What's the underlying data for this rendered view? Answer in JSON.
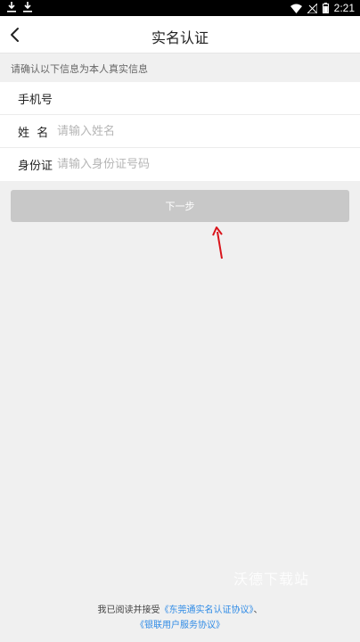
{
  "statusbar": {
    "time": "2:21",
    "icons": [
      "download-icon",
      "download-icon",
      "wifi-icon",
      "signal-off-icon",
      "battery-icon"
    ]
  },
  "nav": {
    "title": "实名认证",
    "back_icon": "back-chevron-icon"
  },
  "hint": "请确认以下信息为本人真实信息",
  "form": {
    "phone_label": "手机号",
    "name_label": "姓  名",
    "name_placeholder": "请输入姓名",
    "id_label": "身份证",
    "id_placeholder": "请输入身份证号码"
  },
  "next_button": "下一步",
  "watermark": "沃德下载站",
  "agreement": {
    "prefix": "我已阅读并接受",
    "link1": "《东莞通实名认证协议》",
    "separator": "、",
    "link2": "《银联用户服务协议》"
  },
  "colors": {
    "link": "#2f8be6",
    "button_disabled": "#c8c8c8",
    "annotation_arrow": "#d9141b"
  }
}
